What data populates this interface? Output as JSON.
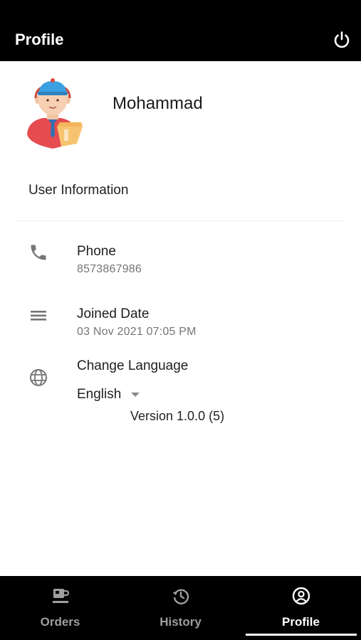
{
  "app_bar": {
    "title": "Profile",
    "power_icon": "power-icon"
  },
  "profile": {
    "name": "Mohammad",
    "avatar": "delivery-person-avatar"
  },
  "user_info": {
    "section_title": "User Information",
    "phone": {
      "label": "Phone",
      "value": "8573867986",
      "icon": "phone-icon"
    },
    "joined": {
      "label": "Joined Date",
      "value": "03 Nov 2021 07:05 PM",
      "icon": "menu-lines-icon"
    },
    "language": {
      "label": "Change Language",
      "selected": "English",
      "icon": "globe-icon"
    }
  },
  "version": "Version 1.0.0 (5)",
  "bottom_nav": {
    "items": [
      {
        "label": "Orders",
        "icon": "cup-icon"
      },
      {
        "label": "History",
        "icon": "history-icon"
      },
      {
        "label": "Profile",
        "icon": "account-circle-icon"
      }
    ],
    "active_index": 2
  },
  "colors": {
    "bar_background": "#000000",
    "active_nav": "#ffffff",
    "inactive_nav": "#9e9e9e",
    "secondary_text": "#757575",
    "icon_gray": "#757575"
  }
}
